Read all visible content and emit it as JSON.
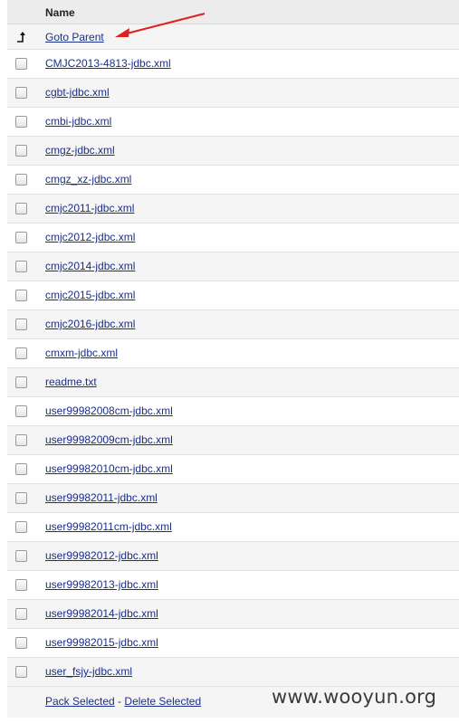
{
  "table": {
    "header": {
      "name_label": "Name"
    },
    "parent_row": {
      "label": "Goto Parent",
      "icon": "up-arrow-icon"
    },
    "files": [
      {
        "name": "CMJC2013-4813-jdbc.xml"
      },
      {
        "name": "cgbt-jdbc.xml"
      },
      {
        "name": "cmbi-jdbc.xml"
      },
      {
        "name": "cmgz-jdbc.xml"
      },
      {
        "name": "cmgz_xz-jdbc.xml"
      },
      {
        "name": "cmjc2011-jdbc.xml"
      },
      {
        "name": "cmjc2012-jdbc.xml"
      },
      {
        "name": "cmjc2014-jdbc.xml"
      },
      {
        "name": "cmjc2015-jdbc.xml"
      },
      {
        "name": "cmjc2016-jdbc.xml"
      },
      {
        "name": "cmxm-jdbc.xml"
      },
      {
        "name": "readme.txt"
      },
      {
        "name": "user99982008cm-jdbc.xml"
      },
      {
        "name": "user99982009cm-jdbc.xml"
      },
      {
        "name": "user99982010cm-jdbc.xml"
      },
      {
        "name": "user99982011-jdbc.xml"
      },
      {
        "name": "user99982011cm-jdbc.xml"
      },
      {
        "name": "user99982012-jdbc.xml"
      },
      {
        "name": "user99982013-jdbc.xml"
      },
      {
        "name": "user99982014-jdbc.xml"
      },
      {
        "name": "user99982015-jdbc.xml"
      },
      {
        "name": "user_fsjy-jdbc.xml"
      }
    ]
  },
  "footer": {
    "pack_label": "Pack Selected",
    "separator": "-",
    "delete_label": "Delete Selected"
  },
  "watermark": "www.wooyun.org",
  "colors": {
    "link": "#1a2f8a",
    "annotation_arrow": "#e02020",
    "alt_row": "#f5f5f5",
    "header_bg": "#ececec"
  }
}
